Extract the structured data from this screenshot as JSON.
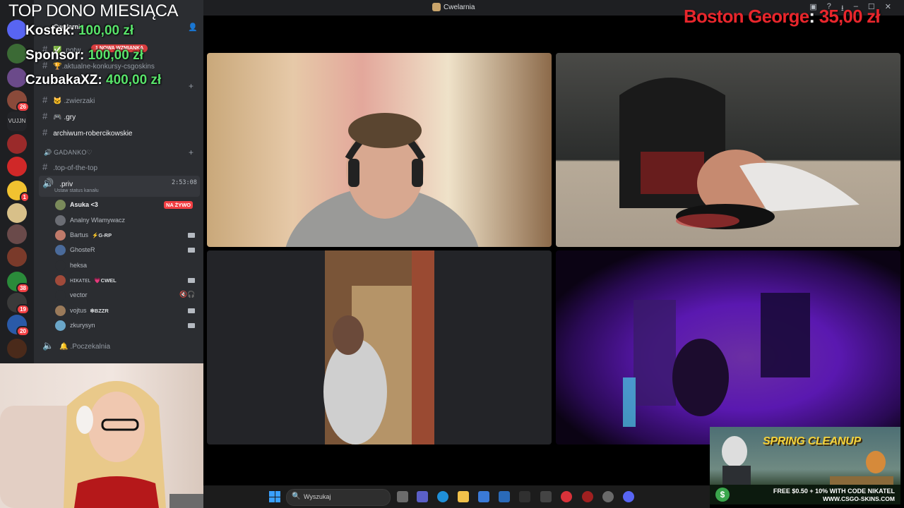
{
  "window": {
    "title": "Cwelarnia",
    "controls": [
      "inbox-icon",
      "help-icon",
      "minimize",
      "maximize",
      "close"
    ]
  },
  "overlay": {
    "title": "TOP DONO MIESIĄCA",
    "donors": [
      {
        "name": "Kostek:",
        "amount": "100,00 zł"
      },
      {
        "name": "Sponsor:",
        "amount": "100,00 zł"
      },
      {
        "name": "CzubakaXZ:",
        "amount": "400,00 zł"
      }
    ],
    "latest": {
      "name": "Boston George",
      "sep": ":",
      "amount": "35,00 zł"
    }
  },
  "sidebar": {
    "server_name": "Cwelarnia",
    "mention_pill": "1 NOWA WZMIANKA",
    "channels": [
      {
        "name": ".potw",
        "icon": "check-icon"
      },
      {
        "name": ".aktualne-konkursy-csgoskins",
        "icon": "trophy-icon"
      },
      {
        "name": ".zwierzaki",
        "icon": "cat-icon"
      },
      {
        "name": ".gry",
        "icon": "gamepad-icon"
      },
      {
        "name": "archiwum-robercikowskie",
        "icon": "hash-icon"
      }
    ],
    "category": "GADANKO♡",
    "text_channels": [
      {
        "name": ".top-of-the-top"
      }
    ],
    "voice_channel": {
      "name": ".priv",
      "timer": "2:53:08",
      "status": "Ustaw status kanału"
    },
    "voice_users": [
      {
        "name": "Asuka <3",
        "tag": "",
        "live": "NA ŻYWO",
        "color": "#7a8a5a"
      },
      {
        "name": "Analny Wlamywacz",
        "tag": "",
        "color": "#6b6d74"
      },
      {
        "name": "Bartus",
        "tag": "⚡G-RP",
        "color": "#c07a6a"
      },
      {
        "name": "GhosteR",
        "tag": "",
        "color": "#4a6a9a"
      },
      {
        "name": "heksa",
        "tag": "",
        "color": "#2b2d31"
      },
      {
        "name": "ʜɪᴋᴀᴛᴇʟ",
        "tag": "💗CWEL",
        "color": "#a04a3a"
      },
      {
        "name": "vector",
        "tag": "",
        "color": "#2b2d31"
      },
      {
        "name": "vojtus",
        "tag": "❇BZZR",
        "color": "#9a7a5a"
      },
      {
        "name": "zkurysyn",
        "tag": "",
        "color": "#6aa6c8"
      }
    ],
    "waiting_room": ".Poczekalnia",
    "rail_badges": [
      "1",
      "26",
      "1",
      "38",
      "19",
      "20"
    ],
    "rail_labels": [
      "VUJJN"
    ]
  },
  "ad": {
    "title": "SPRING CLEANUP",
    "line1": "FREE $0.50 + 10% WITH CODE NIKATEL",
    "line2": "WWW.CSGO-SKINS.COM"
  },
  "taskbar": {
    "search_placeholder": "Wyszukaj"
  }
}
